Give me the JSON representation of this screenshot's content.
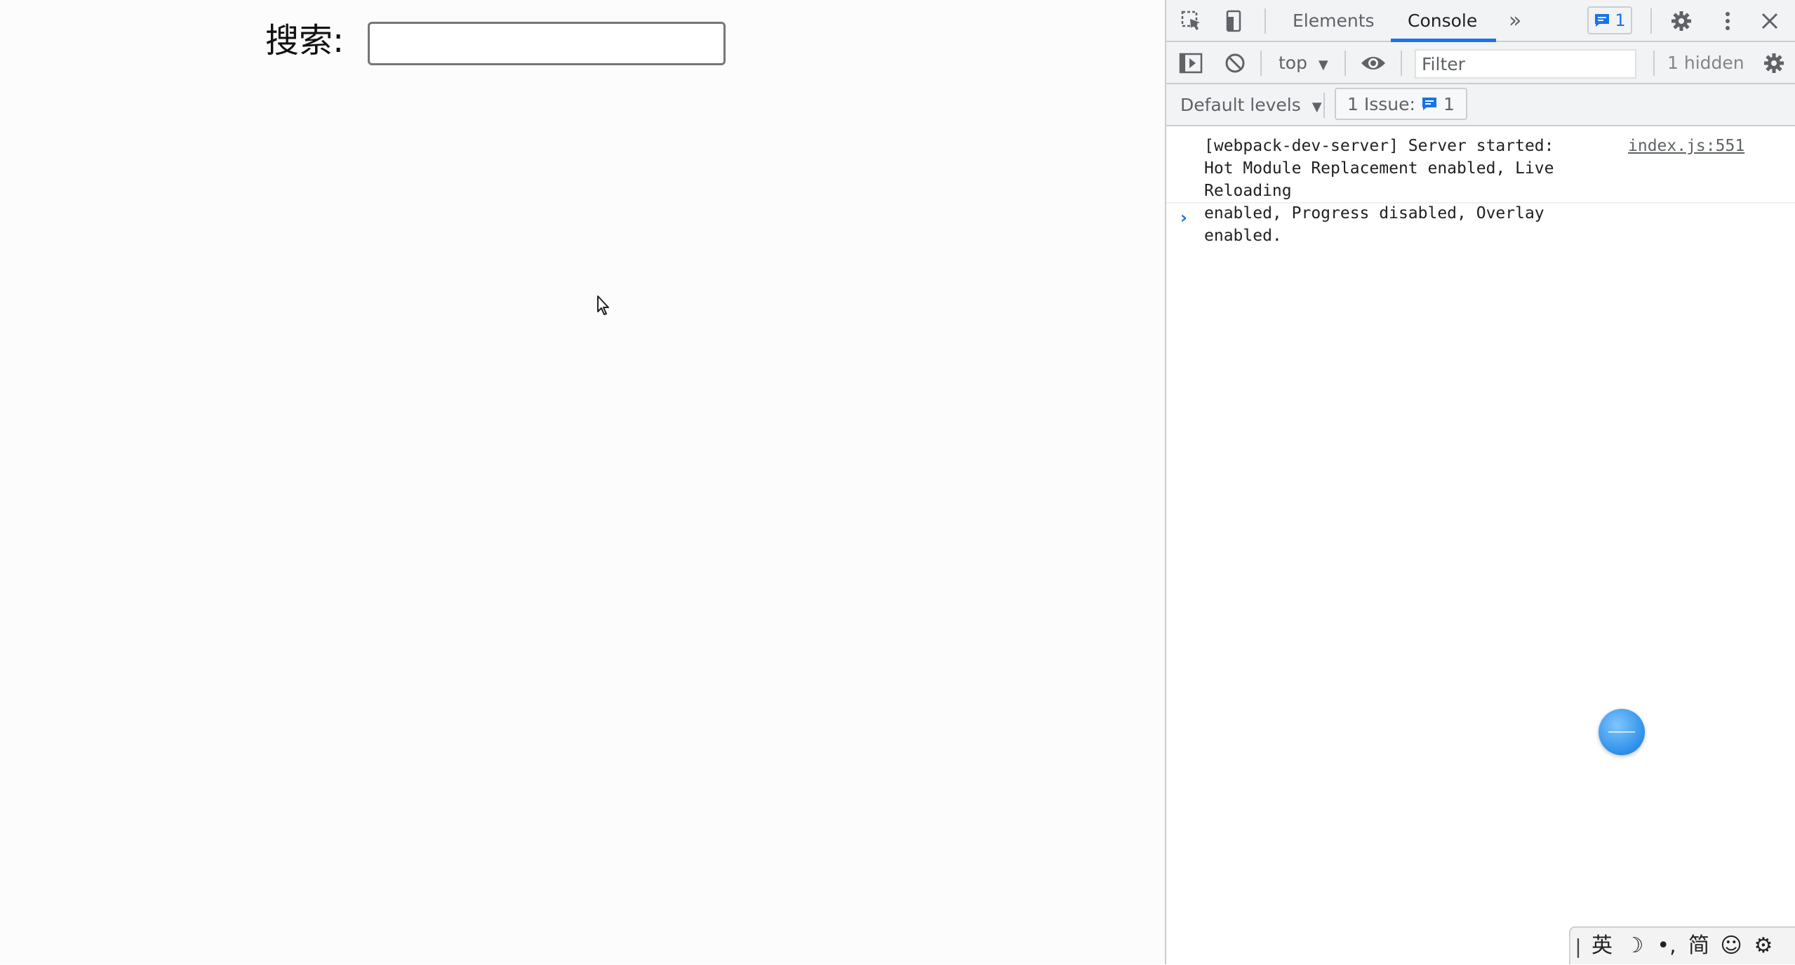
{
  "page": {
    "search_label": "搜索:",
    "search_value": "",
    "search_placeholder": ""
  },
  "devtools": {
    "tabs": [
      {
        "label": "Elements",
        "active": false
      },
      {
        "label": "Console",
        "active": true
      }
    ],
    "more_tabs_glyph": "»",
    "issues_badge_count": "1",
    "context_label": "top",
    "filter_placeholder": "Filter",
    "hidden_label": "1 hidden",
    "levels_label": "Default levels",
    "issue_button_label": "1 Issue:",
    "issue_button_count": "1",
    "messages": [
      {
        "text": "[webpack-dev-server] Server started:\nHot Module Replacement enabled, Live Reloading\nenabled, Progress disabled, Overlay enabled.",
        "source": "index.js:551"
      }
    ],
    "prompt_glyph": "›"
  },
  "ime_bar": {
    "grip": "|",
    "lang": "英",
    "moon": "☽",
    "punct": "•,",
    "script": "简",
    "emoji": "☺",
    "settings": "⚙"
  },
  "colors": {
    "accent": "#1a73e8",
    "toolbar_bg": "#f1f3f4",
    "border": "#cbcdd1"
  }
}
